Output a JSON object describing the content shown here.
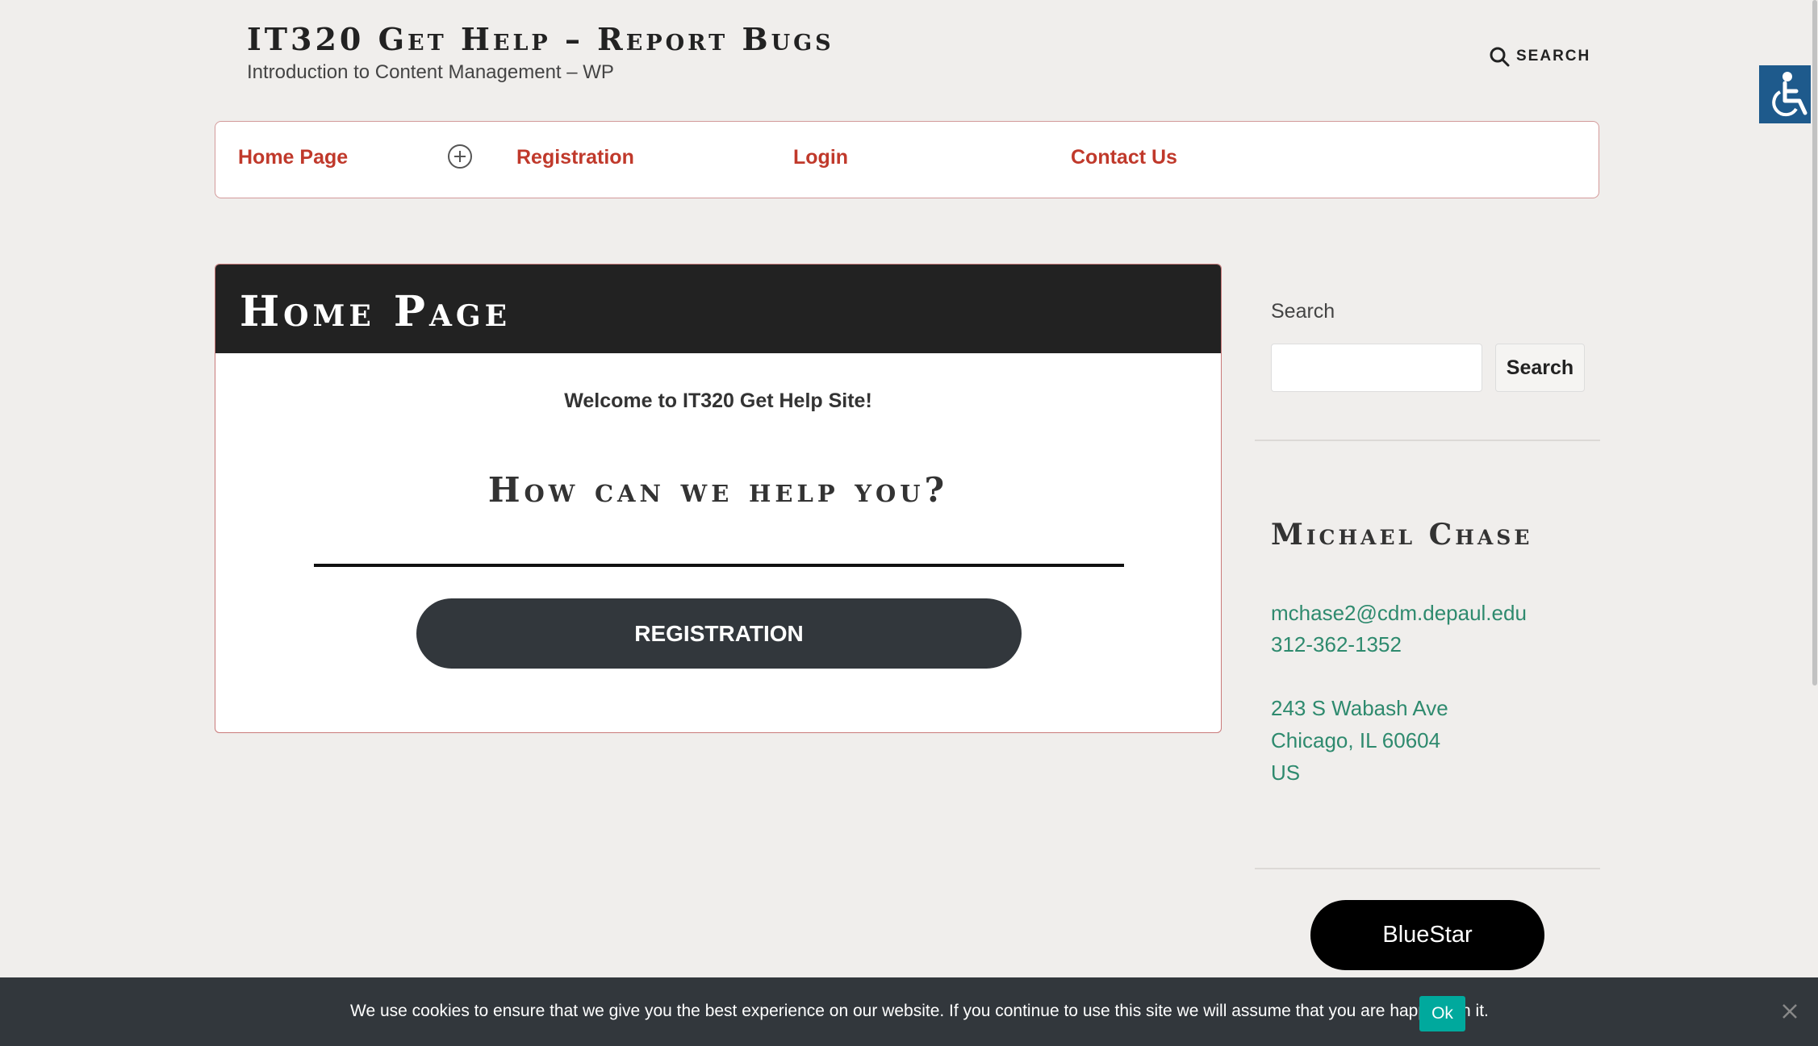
{
  "header": {
    "site_title": "IT320 Get Help – Report Bugs",
    "tagline": "Introduction to Content Management – WP",
    "search_label": "SEARCH"
  },
  "nav": {
    "items": [
      {
        "label": "Home Page"
      },
      {
        "label": "Registration"
      },
      {
        "label": "Login"
      },
      {
        "label": "Contact Us"
      }
    ]
  },
  "main": {
    "page_title": "Home Page",
    "welcome": "Welcome to IT320 Get Help Site!",
    "help_heading": "How can we help you?",
    "registration_button": "REGISTRATION"
  },
  "sidebar": {
    "search_label": "Search",
    "search_value": "",
    "search_button": "Search",
    "contact_title": "Michael Chase",
    "email": "mchase2@cdm.depaul.edu",
    "phone": "312-362-1352",
    "address_line1": "243 S Wabash Ave",
    "address_line2": "Chicago, IL 60604",
    "address_country": "US",
    "bluestar_button": "BlueStar"
  },
  "cookie": {
    "message": "We use cookies to ensure that we give you the best experience on our website. If you continue to use this site we will assume that you are happy with it.",
    "ok_label": "Ok"
  },
  "colors": {
    "nav_link": "#c0392b",
    "contact_link": "#2e8a6e",
    "accessibility": "#1e5a8c",
    "cookie_ok": "#00a99d"
  }
}
